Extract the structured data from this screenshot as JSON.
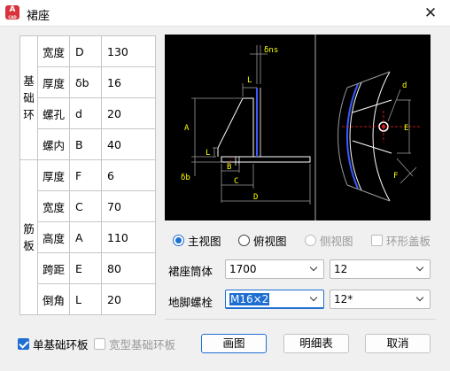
{
  "window": {
    "title": "裙座",
    "app_icon_letter": "A",
    "app_icon_sub": "CAD"
  },
  "params": {
    "groups": [
      {
        "label": "基础环",
        "rows": [
          {
            "name": "宽度",
            "sym": "D",
            "val": "130"
          },
          {
            "name": "厚度",
            "sym": "δb",
            "val": "16"
          },
          {
            "name": "螺孔",
            "sym": "d",
            "val": "20"
          },
          {
            "name": "螺内",
            "sym": "B",
            "val": "40"
          }
        ]
      },
      {
        "label": "筋板",
        "rows": [
          {
            "name": "厚度",
            "sym": "F",
            "val": "6"
          },
          {
            "name": "宽度",
            "sym": "C",
            "val": "70"
          },
          {
            "name": "高度",
            "sym": "A",
            "val": "110"
          },
          {
            "name": "跨距",
            "sym": "E",
            "val": "80"
          },
          {
            "name": "倒角",
            "sym": "L",
            "val": "20"
          }
        ]
      }
    ]
  },
  "drawing": {
    "labels": {
      "dns": "δns",
      "L": "L",
      "A": "A",
      "L2": "L",
      "db": "δb",
      "B": "B",
      "C": "C",
      "D": "D",
      "d": "d",
      "E": "E",
      "F": "F"
    }
  },
  "views": [
    {
      "label": "主视图",
      "checked": true,
      "enabled": true
    },
    {
      "label": "俯视图",
      "checked": false,
      "enabled": true
    },
    {
      "label": "侧视图",
      "checked": false,
      "enabled": false
    }
  ],
  "ring_cover": {
    "label": "环形盖板",
    "checked": false,
    "enabled": false
  },
  "skirt": {
    "label": "裙座筒体",
    "value1": "1700",
    "value2": "12"
  },
  "bolt": {
    "label": "地脚螺栓",
    "value1": "M16×2",
    "value2": "12*"
  },
  "options": [
    {
      "label": "单基础环板",
      "checked": true,
      "enabled": true
    },
    {
      "label": "宽型基础环板",
      "checked": false,
      "enabled": false
    }
  ],
  "buttons": {
    "draw": "画图",
    "detail": "明细表",
    "cancel": "取消"
  },
  "colors": {
    "accent": "#1f6fd1",
    "cad_yellow": "#ffff00",
    "cad_blue": "#3a5bff",
    "cad_red": "#ff2020"
  }
}
